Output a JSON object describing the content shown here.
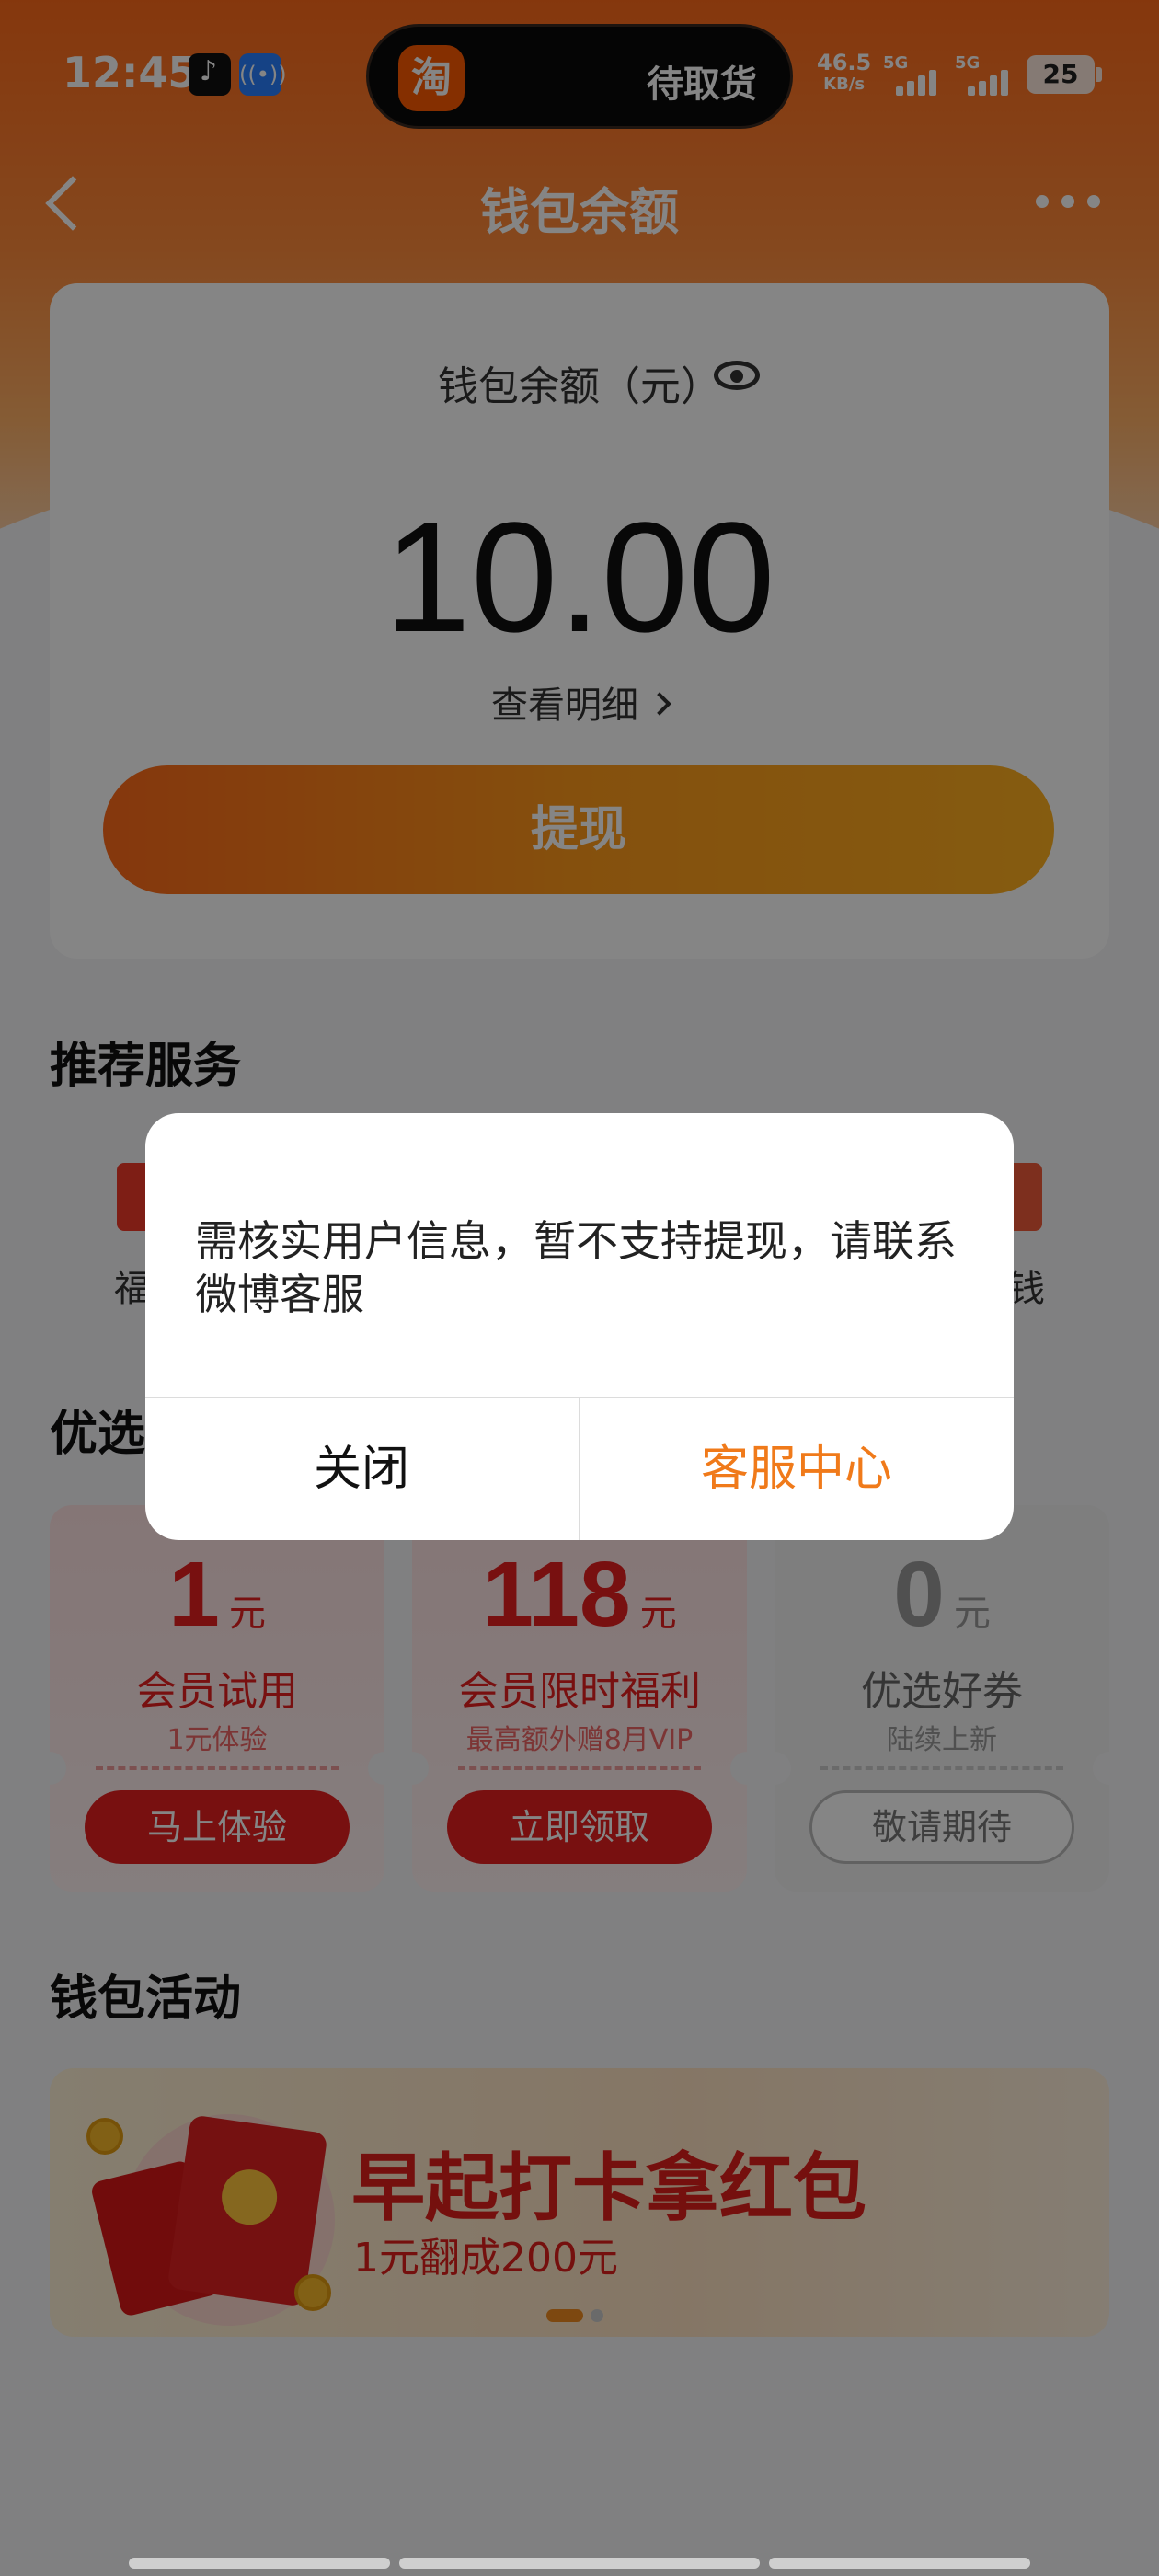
{
  "status_bar": {
    "time": "12:45",
    "island_logo": "淘",
    "island_text": "待取货",
    "net_speed": "46.5",
    "net_speed_unit": "KB/s",
    "signal1": "5G",
    "signal2": "5G",
    "battery": "25"
  },
  "nav": {
    "title": "钱包余额"
  },
  "balance": {
    "label": "钱包余额（元）",
    "amount": "10.00",
    "detail_link": "查看明细",
    "withdraw": "提现"
  },
  "services": {
    "title": "推荐服务",
    "left_partial_label": "福利",
    "right_partial_label": "换钱"
  },
  "coupons": {
    "title_partial": "优选",
    "items": [
      {
        "value": "1",
        "unit": "元",
        "title": "会员试用",
        "sub": "1元体验",
        "button": "马上体验"
      },
      {
        "value": "118",
        "unit": "元",
        "title": "会员限时福利",
        "sub": "最高额外赠8月VIP",
        "button": "立即领取"
      },
      {
        "value": "0",
        "unit": "元",
        "title": "优选好券",
        "sub": "陆续上新",
        "button": "敬请期待"
      }
    ]
  },
  "activities": {
    "title": "钱包活动",
    "banner_title": "早起打卡拿红包",
    "banner_sub": "1元翻成200元"
  },
  "dialog": {
    "message": "需核实用户信息，暂不支持提现，请联系微博客服",
    "close_button": "关闭",
    "service_button": "客服中心"
  },
  "colors": {
    "accent": "#ff6a1a",
    "dialog_action": "#f07a1a",
    "coupon_red": "#e62020"
  }
}
